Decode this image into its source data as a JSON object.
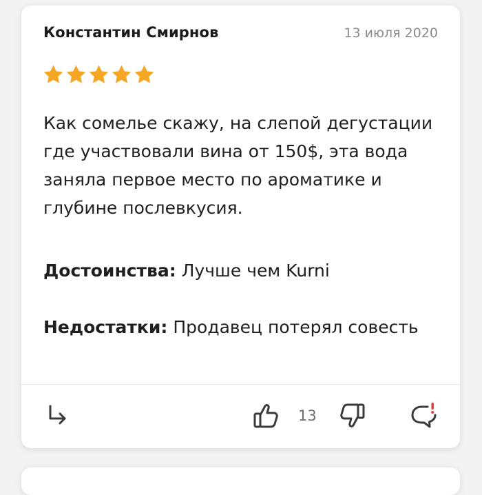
{
  "review": {
    "author": "Константин Смирнов",
    "date": "13 июля 2020",
    "rating": 5,
    "rating_max": 5,
    "text": "Как сомелье скажу, на слепой дегустации где участвовали вина от 150$, эта вода заняла первое место по ароматике и глубине послевкусия.",
    "pros_label": "Достоинства:",
    "pros_value": "Лучше чем Kurni",
    "cons_label": "Недостатки:",
    "cons_value": "Продавец потерял совесть"
  },
  "actions": {
    "likes": "13"
  },
  "icons": {
    "star": "star-icon",
    "reply": "reply-arrow-icon",
    "like": "thumbs-up-icon",
    "dislike": "thumbs-down-icon",
    "report": "report-comment-icon"
  },
  "colors": {
    "star": "#F5A623",
    "report_accent": "#E53935",
    "text": "#1F1F1F",
    "muted": "#8A8A8A"
  }
}
